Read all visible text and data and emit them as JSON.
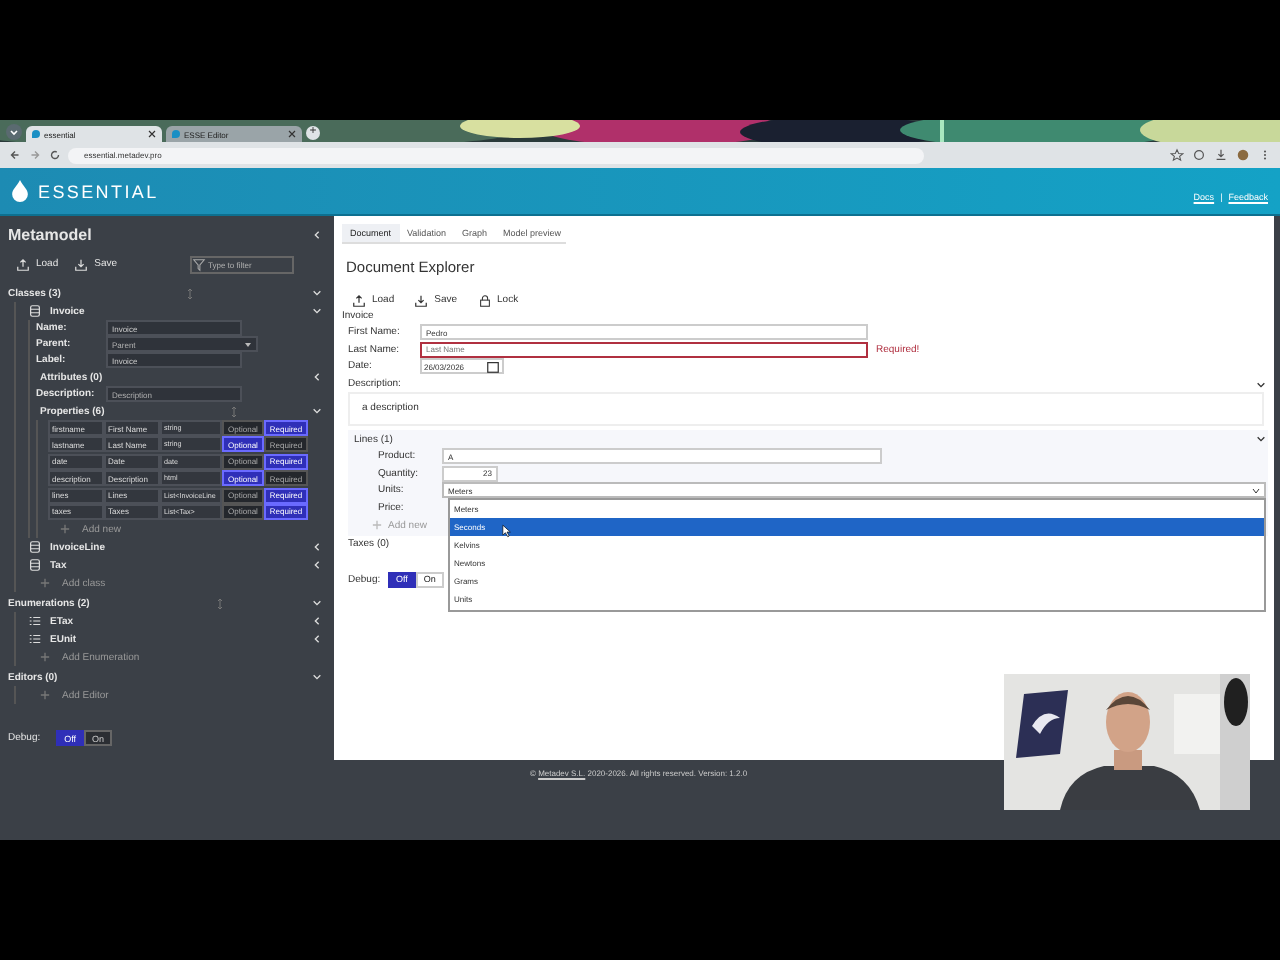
{
  "browser": {
    "tabs": [
      {
        "title": "essential",
        "selected": true
      },
      {
        "title": "ESSE Editor",
        "selected": false
      }
    ],
    "new_tab": "+",
    "address": "essential.metadev.pro"
  },
  "header": {
    "brand": "ESSENTIAL",
    "links": [
      "Docs",
      "Feedback"
    ],
    "separator": "|"
  },
  "sidebar": {
    "title": "Metamodel",
    "actions": [
      "Load",
      "Save"
    ],
    "filter": {
      "placeholder": "Type to filter"
    },
    "classes": {
      "title": "Classes (3)",
      "expanded": true,
      "add": "Add class",
      "items": [
        {
          "name": "Invoice",
          "expanded": true
        },
        {
          "name": "InvoiceLine",
          "expanded": false
        },
        {
          "name": "Tax",
          "expanded": false
        }
      ]
    },
    "invoice": {
      "fields": [
        {
          "label": "Name:",
          "value": "Invoice"
        },
        {
          "label": "Parent:",
          "placeholder": "Parent"
        },
        {
          "label": "Label:",
          "value": "Invoice"
        }
      ],
      "attributes": {
        "title": "Attributes (0)",
        "expanded": false
      },
      "description": {
        "label": "Description:",
        "placeholder": "Description"
      },
      "properties": {
        "title": "Properties (6)",
        "expanded": true,
        "add": "Add new",
        "rows": [
          {
            "name": "firstname",
            "label": "First Name",
            "type": "string",
            "options": [
              {
                "label": "Optional",
                "selected": false
              },
              {
                "label": "Required",
                "selected": true
              }
            ]
          },
          {
            "name": "lastname",
            "label": "Last Name",
            "type": "string",
            "options": [
              {
                "label": "Optional",
                "selected": true
              },
              {
                "label": "Required",
                "selected": false
              }
            ]
          },
          {
            "name": "date",
            "label": "Date",
            "type": "date",
            "options": [
              {
                "label": "Optional",
                "selected": false
              },
              {
                "label": "Required",
                "selected": true
              }
            ]
          },
          {
            "name": "description",
            "label": "Description",
            "type": "html",
            "options": [
              {
                "label": "Optional",
                "selected": true
              },
              {
                "label": "Required",
                "selected": false
              }
            ]
          },
          {
            "name": "lines",
            "label": "Lines",
            "type": "List<InvoiceLine",
            "options": [
              {
                "label": "Optional",
                "selected": false
              },
              {
                "label": "Required",
                "selected": true
              }
            ]
          },
          {
            "name": "taxes",
            "label": "Taxes",
            "type": "List<Tax>",
            "options": [
              {
                "label": "Optional",
                "selected": false
              },
              {
                "label": "Required",
                "selected": true
              }
            ]
          }
        ]
      }
    },
    "enumerations": {
      "title": "Enumerations (2)",
      "expanded": true,
      "add": "Add Enumeration",
      "items": [
        {
          "name": "ETax",
          "expanded": false
        },
        {
          "name": "EUnit",
          "expanded": false
        }
      ]
    },
    "editors": {
      "title": "Editors (0)",
      "expanded": true,
      "add": "Add Editor"
    },
    "debug": {
      "label": "Debug:",
      "options": [
        {
          "label": "Off",
          "selected": true
        },
        {
          "label": "On",
          "selected": false
        }
      ]
    }
  },
  "content": {
    "tabs": [
      {
        "label": "Document",
        "selected": true
      },
      {
        "label": "Validation",
        "selected": false
      },
      {
        "label": "Graph",
        "selected": false
      },
      {
        "label": "Model preview",
        "selected": false
      }
    ],
    "title": "Document Explorer",
    "actions": [
      "Load",
      "Save",
      "Lock"
    ],
    "group": "Invoice",
    "fields": [
      {
        "label": "First Name:",
        "value": "Pedro"
      },
      {
        "label": "Last Name:",
        "placeholder": "Last Name",
        "error": "Required!"
      },
      {
        "label": "Date:",
        "value": "26/03/2026"
      }
    ],
    "description": {
      "label": "Description:",
      "value": "a description"
    },
    "lines": {
      "title": "Lines (1)",
      "expanded": true,
      "product": {
        "label": "Product:",
        "value": "A"
      },
      "quantity": {
        "label": "Quantity:",
        "value": "23"
      },
      "units": {
        "label": "Units:",
        "value": "Meters"
      },
      "price": {
        "label": "Price:"
      },
      "add": "Add new",
      "options": [
        {
          "label": "Meters",
          "selected": false
        },
        {
          "label": "Seconds",
          "selected": true
        },
        {
          "label": "Kelvins",
          "selected": false
        },
        {
          "label": "Newtons",
          "selected": false
        },
        {
          "label": "Grams",
          "selected": false
        },
        {
          "label": "Units",
          "selected": false
        }
      ]
    },
    "taxes": {
      "title": "Taxes (0)"
    },
    "debug": {
      "label": "Debug:",
      "options": [
        {
          "label": "Off",
          "selected": true
        },
        {
          "label": "On",
          "selected": false
        }
      ]
    }
  },
  "footer": {
    "before": "©",
    "link": "Metadev S.L.",
    "after": "2020-2026. All rights reserved.   Version: 1.2.0"
  }
}
